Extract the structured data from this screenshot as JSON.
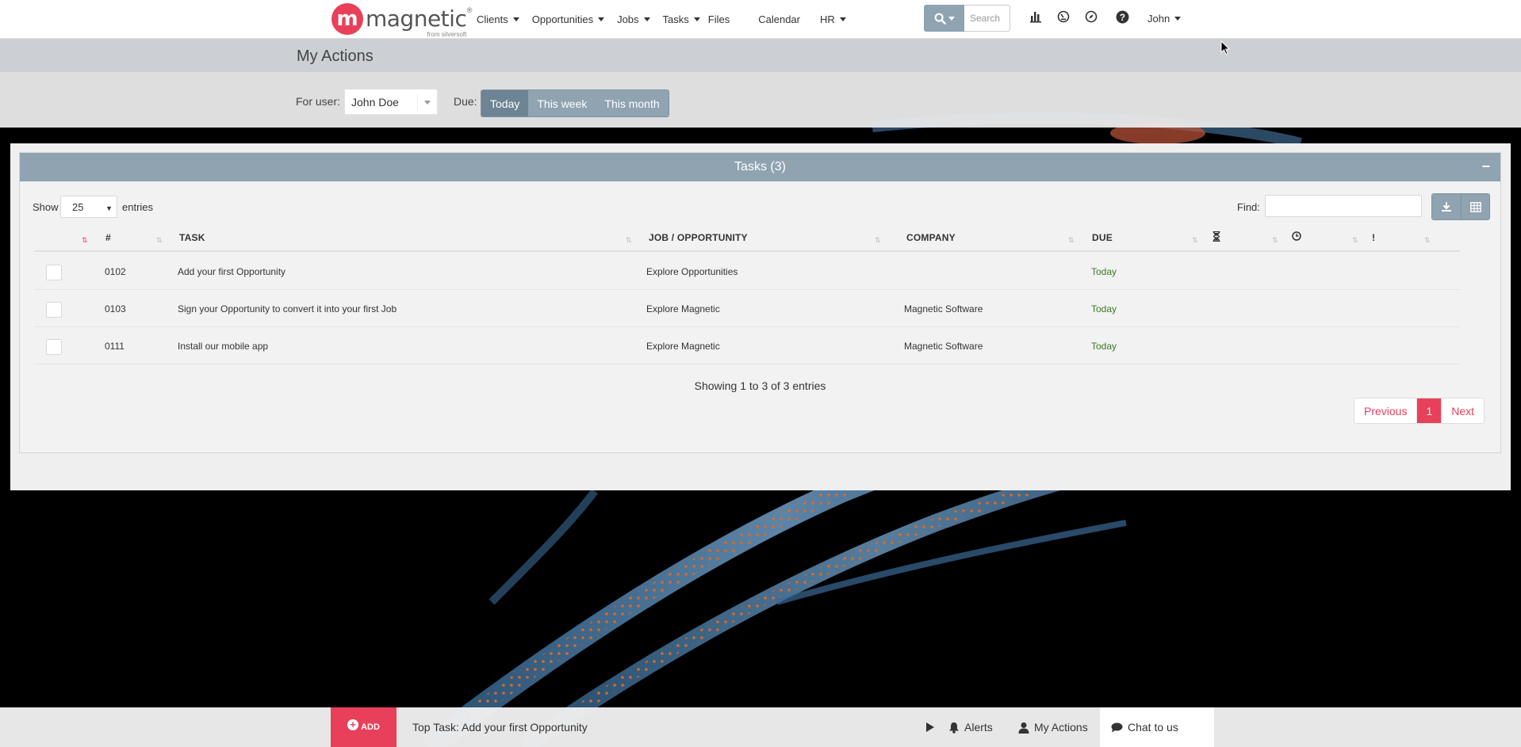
{
  "brand": {
    "mark": "m",
    "name": "magnetic",
    "tagline": "from silversoft",
    "registered": "®"
  },
  "nav": {
    "items": [
      {
        "label": "Clients",
        "dropdown": true
      },
      {
        "label": "Opportunities",
        "dropdown": true
      },
      {
        "label": "Jobs",
        "dropdown": true
      },
      {
        "label": "Tasks",
        "dropdown": true
      },
      {
        "label": "Files",
        "dropdown": false
      },
      {
        "label": "Calendar",
        "dropdown": false
      },
      {
        "label": "HR",
        "dropdown": true
      }
    ],
    "search_placeholder": "Search",
    "icons": [
      "bar-chart-icon",
      "dashboard-icon",
      "compass-icon",
      "help-icon"
    ],
    "user": "John"
  },
  "page": {
    "title": "My Actions",
    "for_user_label": "For user:",
    "selected_user": "John Doe",
    "due_label": "Due:",
    "due_options": [
      "Today",
      "This week",
      "This month"
    ],
    "due_selected": "Today"
  },
  "panel": {
    "title": "Tasks (3)",
    "collapse": "−",
    "show_label": "Show",
    "page_length": "25",
    "entries_label": "entries",
    "find_label": "Find:",
    "columns": [
      "#",
      "TASK",
      "JOB / OPPORTUNITY",
      "COMPANY",
      "DUE",
      "hourglass-icon",
      "clock-icon",
      "priority-icon"
    ],
    "header_glyphs": {
      "priority": "!"
    },
    "rows": [
      {
        "id": "0102",
        "task": "Add your first Opportunity",
        "job": "Explore Opportunities",
        "company": "",
        "due": "Today"
      },
      {
        "id": "0103",
        "task": "Sign your Opportunity to convert it into your first Job",
        "job": "Explore Magnetic",
        "company": "Magnetic Software",
        "due": "Today"
      },
      {
        "id": "0111",
        "task": "Install our mobile app",
        "job": "Explore Magnetic",
        "company": "Magnetic Software",
        "due": "Today"
      }
    ],
    "info": "Showing 1 to 3 of 3 entries",
    "pager": {
      "previous": "Previous",
      "current": "1",
      "next": "Next"
    }
  },
  "footer": {
    "add_label": "ADD",
    "top_task": "Top Task: Add your first Opportunity",
    "alerts": "Alerts",
    "my_actions": "My Actions",
    "chat": "Chat to us"
  },
  "colors": {
    "brand": "#e8405a",
    "accent": "#8fa3b1",
    "due_today": "#3b7a1f"
  }
}
